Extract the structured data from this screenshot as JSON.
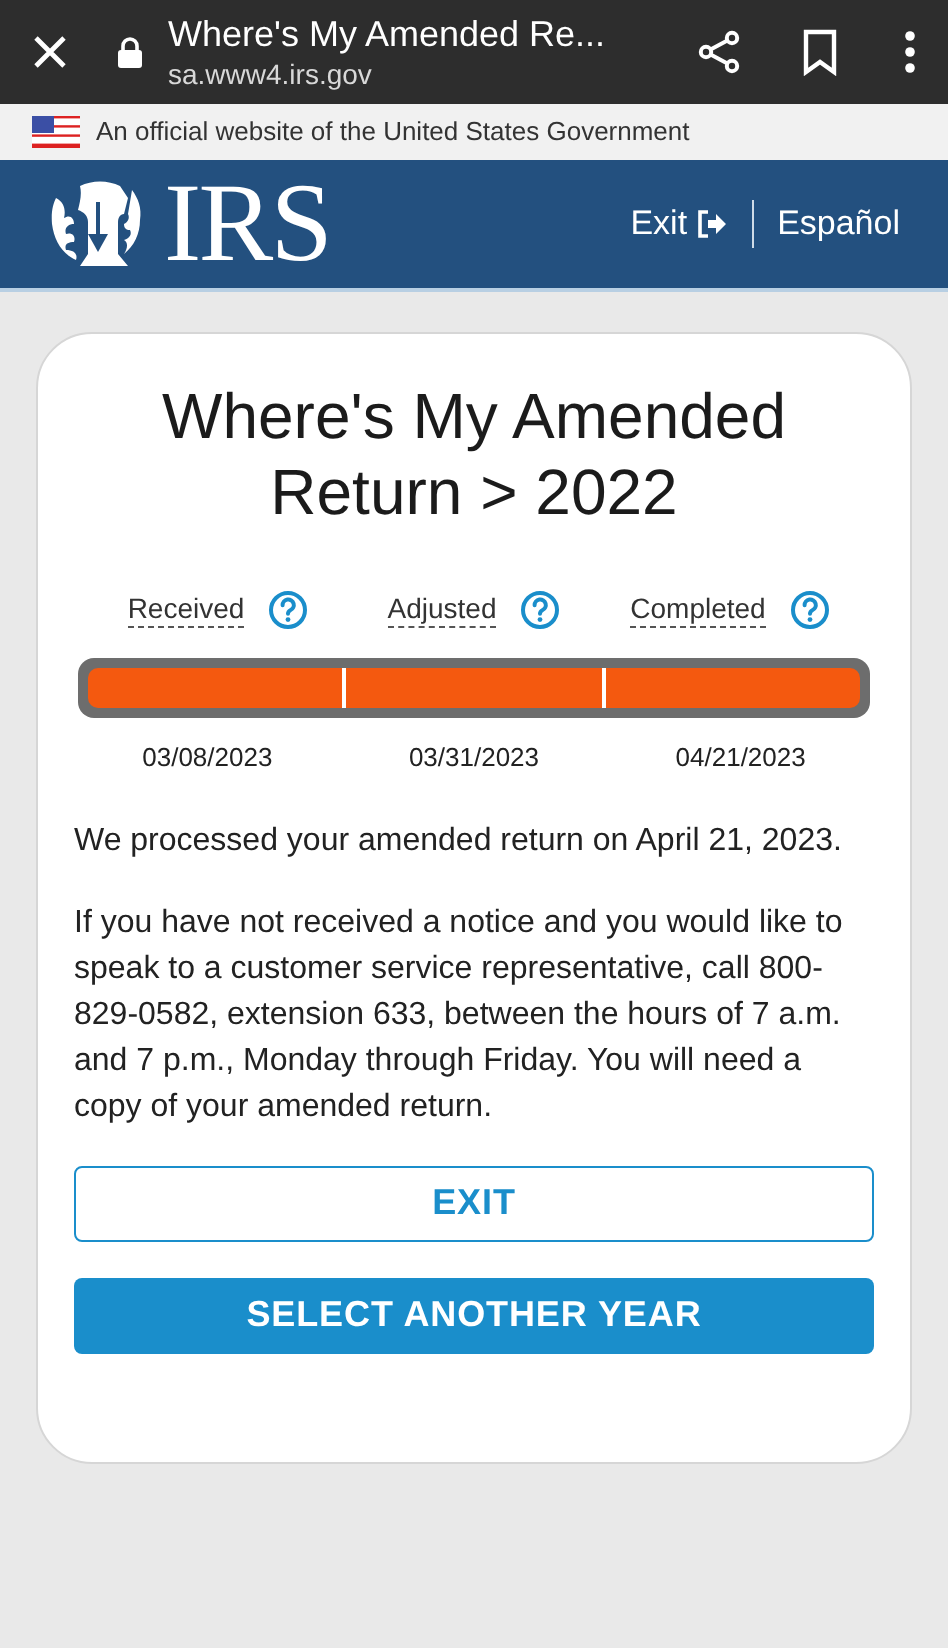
{
  "browser": {
    "title": "Where's My Amended Re...",
    "url": "sa.www4.irs.gov"
  },
  "gov_banner": "An official website of the United States Government",
  "header": {
    "logo_text": "IRS",
    "exit": "Exit",
    "language": "Español"
  },
  "card": {
    "title": "Where's My Amended Return > 2022",
    "stages": [
      {
        "label": "Received",
        "date": "03/08/2023",
        "done": true
      },
      {
        "label": "Adjusted",
        "date": "03/31/2023",
        "done": true
      },
      {
        "label": "Completed",
        "date": "04/21/2023",
        "done": true
      }
    ],
    "paragraphs": [
      "We processed your amended return on April 21, 2023.",
      "If you have not received a notice and you would like to speak to a customer service representative, call 800-829-0582, extension 633, between the hours of 7 a.m. and 7 p.m., Monday through Friday. You will need a copy of your amended return."
    ],
    "buttons": [
      {
        "label": "EXIT",
        "kind": "outline"
      },
      {
        "label": "SELECT ANOTHER YEAR",
        "kind": "filled"
      }
    ]
  }
}
